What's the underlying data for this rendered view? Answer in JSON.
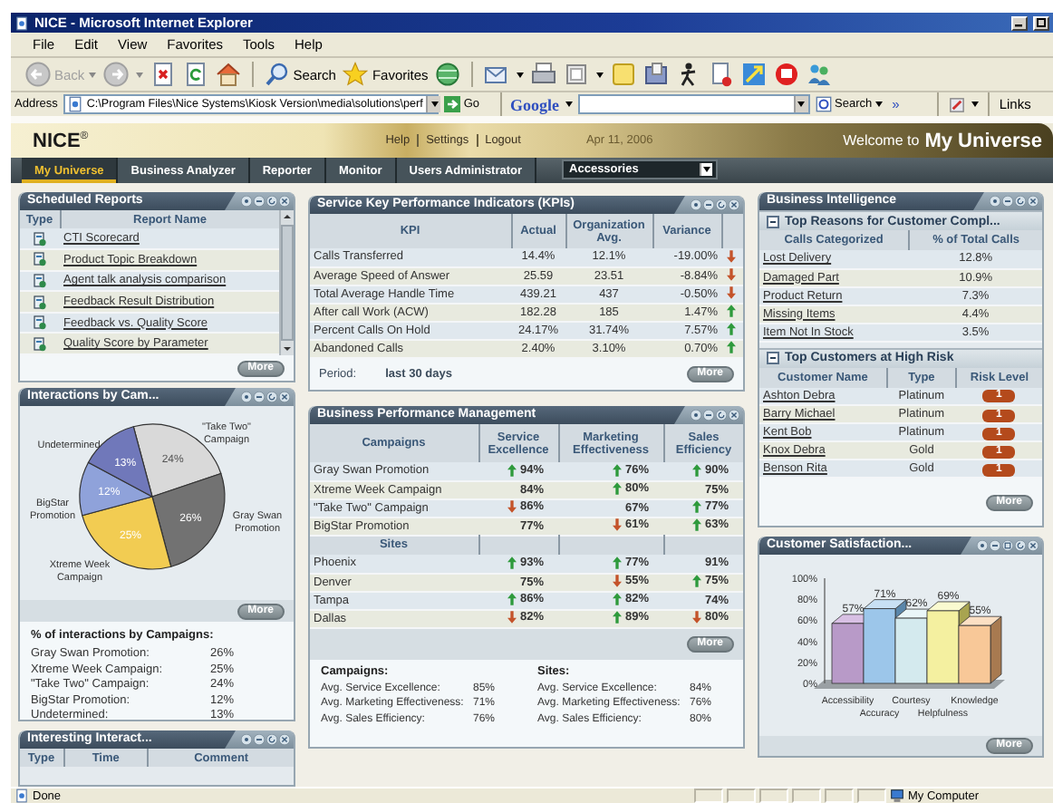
{
  "window": {
    "title": "NICE - Microsoft Internet Explorer"
  },
  "menu": [
    "File",
    "Edit",
    "View",
    "Favorites",
    "Tools",
    "Help"
  ],
  "toolbar": {
    "back": {
      "label": "Back",
      "disabled": true
    },
    "search": "Search",
    "favorites": "Favorites"
  },
  "address_bar": {
    "label": "Address",
    "value": "C:\\Program Files\\Nice Systems\\Kiosk Version\\media\\solutions\\perf",
    "go": "Go",
    "google": "Google",
    "search": "Search",
    "more": "»",
    "links": "Links"
  },
  "header": {
    "logo": "NICE",
    "logo_mark": "®",
    "links": [
      "Help",
      "Settings",
      "Logout"
    ],
    "date": "Apr 11, 2006",
    "welcome": "Welcome to",
    "welcome_name": "My Universe"
  },
  "nav": {
    "tabs": [
      {
        "label": "My Universe",
        "selected": true
      },
      {
        "label": "Business Analyzer",
        "selected": false
      },
      {
        "label": "Reporter",
        "selected": false
      },
      {
        "label": "Monitor",
        "selected": false
      },
      {
        "label": "Users Administrator",
        "selected": false
      }
    ],
    "dropdown": "Accessories"
  },
  "scheduled_reports": {
    "title": "Scheduled Reports",
    "columns": [
      "Type",
      "Report Name"
    ],
    "rows": [
      "CTI Scorecard",
      "Product Topic Breakdown",
      "Agent talk analysis comparison",
      "Feedback Result Distribution",
      "Feedback vs. Quality Score",
      "Quality Score by Parameter"
    ],
    "more": "More"
  },
  "interactions": {
    "title": "Interactions by Cam...",
    "chart_data": {
      "type": "pie",
      "categories": [
        "\"Take Two\" Campaign",
        "Gray Swan Promotion",
        "Xtreme Week Campaign",
        "BigStar Promotion",
        "Undetermined"
      ],
      "values": [
        24,
        26,
        25,
        12,
        13
      ],
      "value_labels": [
        "24%",
        "26%",
        "25%",
        "12%",
        "13%"
      ]
    },
    "more": "More",
    "summary": {
      "title": "% of interactions by Campaigns:",
      "rows": [
        {
          "label": "Gray Swan Promotion:",
          "value": "26%"
        },
        {
          "label": "Xtreme Week Campaign:",
          "value": "25%"
        },
        {
          "label": "\"Take Two\" Campaign:",
          "value": "24%"
        },
        {
          "label": "BigStar Promotion:",
          "value": "12%"
        },
        {
          "label": "Undetermined:",
          "value": "13%"
        }
      ]
    }
  },
  "interesting": {
    "title": "Interesting Interact...",
    "columns": [
      "Type",
      "Time",
      "Comment"
    ]
  },
  "kpi": {
    "title": "Service Key Performance Indicators (KPIs)",
    "columns": [
      "KPI",
      "Actual",
      "Organization Avg.",
      "Variance"
    ],
    "rows": [
      {
        "kpi": "Calls Transferred",
        "actual": "14.4%",
        "org_avg": "12.1%",
        "variance": "-19.00%",
        "rising": false,
        "falling": true
      },
      {
        "kpi": "Average Speed of Answer",
        "actual": "25.59",
        "org_avg": "23.51",
        "variance": "-8.84%",
        "rising": false,
        "falling": true
      },
      {
        "kpi": "Total Average Handle Time",
        "actual": "439.21",
        "org_avg": "437",
        "variance": "-0.50%",
        "rising": false,
        "falling": true
      },
      {
        "kpi": "After call Work (ACW)",
        "actual": "182.28",
        "org_avg": "185",
        "variance": "1.47%",
        "rising": true,
        "falling": false
      },
      {
        "kpi": "Percent Calls On Hold",
        "actual": "24.17%",
        "org_avg": "31.74%",
        "variance": "7.57%",
        "rising": true,
        "falling": false
      },
      {
        "kpi": "Abandoned Calls",
        "actual": "2.40%",
        "org_avg": "3.10%",
        "variance": "0.70%",
        "rising": true,
        "falling": false
      }
    ],
    "period_label": "Period:",
    "period": "last 30 days",
    "more": "More"
  },
  "bpm": {
    "title": "Business Performance Management",
    "columns": [
      "Campaigns",
      "Service Excellence",
      "Marketing Effectiveness",
      "Sales Efficiency"
    ],
    "campaigns": [
      {
        "name": "Gray Swan Promotion",
        "cells": [
          {
            "value": "94%",
            "rising": true,
            "falling": false
          },
          {
            "value": "76%",
            "rising": true,
            "falling": false
          },
          {
            "value": "90%",
            "rising": true,
            "falling": false
          }
        ]
      },
      {
        "name": "Xtreme Week Campaign",
        "cells": [
          {
            "value": "84%",
            "rising": false,
            "falling": false
          },
          {
            "value": "80%",
            "rising": true,
            "falling": false
          },
          {
            "value": "75%",
            "rising": false,
            "falling": false
          }
        ]
      },
      {
        "name": "\"Take Two\" Campaign",
        "cells": [
          {
            "value": "86%",
            "rising": false,
            "falling": true
          },
          {
            "value": "67%",
            "rising": false,
            "falling": false
          },
          {
            "value": "77%",
            "rising": true,
            "falling": false
          }
        ]
      },
      {
        "name": "BigStar Promotion",
        "cells": [
          {
            "value": "77%",
            "rising": false,
            "falling": false
          },
          {
            "value": "61%",
            "rising": false,
            "falling": true
          },
          {
            "value": "63%",
            "rising": true,
            "falling": false
          }
        ]
      }
    ],
    "sites_label": "Sites",
    "sites": [
      {
        "name": "Phoenix",
        "cells": [
          {
            "value": "93%",
            "rising": true,
            "falling": false
          },
          {
            "value": "77%",
            "rising": true,
            "falling": false
          },
          {
            "value": "91%",
            "rising": false,
            "falling": false
          }
        ]
      },
      {
        "name": "Denver",
        "cells": [
          {
            "value": "75%",
            "rising": false,
            "falling": false
          },
          {
            "value": "55%",
            "rising": false,
            "falling": true
          },
          {
            "value": "75%",
            "rising": true,
            "falling": false
          }
        ]
      },
      {
        "name": "Tampa",
        "cells": [
          {
            "value": "86%",
            "rising": true,
            "falling": false
          },
          {
            "value": "82%",
            "rising": true,
            "falling": false
          },
          {
            "value": "74%",
            "rising": false,
            "falling": false
          }
        ]
      },
      {
        "name": "Dallas",
        "cells": [
          {
            "value": "82%",
            "rising": false,
            "falling": true
          },
          {
            "value": "89%",
            "rising": true,
            "falling": false
          },
          {
            "value": "80%",
            "rising": false,
            "falling": true
          }
        ]
      }
    ],
    "more": "More",
    "summary": [
      {
        "title": "Campaigns:",
        "rows": [
          {
            "label": "Avg. Service Excellence:",
            "value": "85%"
          },
          {
            "label": "Avg. Marketing Effectiveness:",
            "value": "71%"
          },
          {
            "label": "Avg. Sales Efficiency:",
            "value": "76%"
          }
        ]
      },
      {
        "title": "Sites:",
        "rows": [
          {
            "label": "Avg. Service Excellence:",
            "value": "84%"
          },
          {
            "label": "Avg. Marketing Effectiveness:",
            "value": "76%"
          },
          {
            "label": "Avg. Sales Efficiency:",
            "value": "80%"
          }
        ]
      }
    ]
  },
  "bi": {
    "title": "Business Intelligence",
    "complaints": {
      "title": "Top Reasons for Customer Compl...",
      "expanded": true,
      "columns": [
        "Calls Categorized",
        "% of Total Calls"
      ],
      "rows": [
        {
          "reason": "Lost Delivery",
          "share": "12.8%"
        },
        {
          "reason": "Damaged Part",
          "share": "10.9%"
        },
        {
          "reason": "Product Return",
          "share": "7.3%"
        },
        {
          "reason": "Missing Items",
          "share": "4.4%"
        },
        {
          "reason": "Item Not In Stock",
          "share": "3.5%"
        }
      ]
    },
    "risk": {
      "title": "Top Customers at High Risk",
      "expanded": true,
      "columns": [
        "Customer Name",
        "Type",
        "Risk Level"
      ],
      "rows": [
        {
          "name": "Ashton Debra",
          "type": "Platinum",
          "risk": "1"
        },
        {
          "name": "Barry Michael",
          "type": "Platinum",
          "risk": "1"
        },
        {
          "name": "Kent Bob",
          "type": "Platinum",
          "risk": "1"
        },
        {
          "name": "Knox Debra",
          "type": "Gold",
          "risk": "1"
        },
        {
          "name": "Benson Rita",
          "type": "Gold",
          "risk": "1"
        }
      ]
    },
    "more": "More"
  },
  "satisfaction": {
    "title": "Customer Satisfaction...",
    "chart_data": {
      "type": "bar",
      "categories": [
        "Accessibility",
        "Accuracy",
        "Courtesy",
        "Helpfulness",
        "Knowledge"
      ],
      "values": [
        57,
        71,
        62,
        69,
        55
      ],
      "ylim": [
        0,
        100
      ],
      "yticks": [
        {
          "value": 0,
          "label": "0%"
        },
        {
          "value": 20,
          "label": "20%"
        },
        {
          "value": 40,
          "label": "40%"
        },
        {
          "value": 60,
          "label": "60%"
        },
        {
          "value": 80,
          "label": "80%"
        },
        {
          "value": 100,
          "label": "100%"
        }
      ],
      "value_labels": [
        "57%",
        "71%",
        "62%",
        "69%",
        "55%"
      ]
    },
    "more": "More"
  },
  "status_bar": {
    "text": "Done",
    "zone": "My Computer"
  }
}
